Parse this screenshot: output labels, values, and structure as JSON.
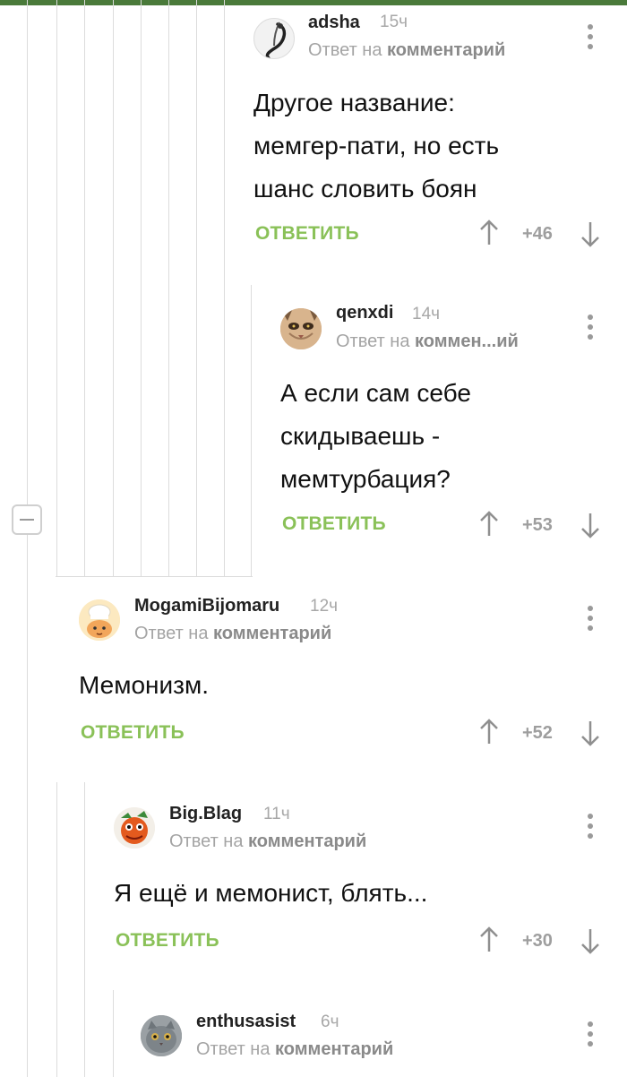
{
  "comments": [
    {
      "author": "adsha",
      "time": "15ч",
      "reply_prefix": "Ответ на",
      "reply_target": "комментарий",
      "text_lines": [
        "Другое название:",
        "мемгер-пати, но есть",
        "шанс словить боян"
      ],
      "reply_label": "ОТВЕТИТЬ",
      "score": "+46",
      "avatar_icon": "cord-loop-icon"
    },
    {
      "author": "qenxdi",
      "time": "14ч",
      "reply_prefix": "Ответ на",
      "reply_target": "коммен...ий",
      "text_lines": [
        "А если сам себе",
        "скидываешь -",
        "мемтурбация?"
      ],
      "reply_label": "ОТВЕТИТЬ",
      "score": "+53",
      "avatar_icon": "cat-face-icon"
    },
    {
      "author": "MogamiBijomaru",
      "time": "12ч",
      "reply_prefix": "Ответ на",
      "reply_target": "комментарий",
      "text_lines": [
        "Мемонизм."
      ],
      "reply_label": "ОТВЕТИТЬ",
      "score": "+52",
      "avatar_icon": "anime-chef-icon"
    },
    {
      "author": "Big.Blag",
      "time": "11ч",
      "reply_prefix": "Ответ на",
      "reply_target": "комментарий",
      "text_lines": [
        "Я ещё и мемонист, блять..."
      ],
      "reply_label": "ОТВЕТИТЬ",
      "score": "+30",
      "avatar_icon": "cartoon-character-icon"
    },
    {
      "author": "enthusasist",
      "time": "6ч",
      "reply_prefix": "Ответ на",
      "reply_target": "комментарий",
      "avatar_icon": "gray-cat-icon"
    }
  ],
  "colors": {
    "accent_green": "#8ac158",
    "top_bar": "#4a7a3a",
    "thread_line": "#dcdcdc",
    "muted_text": "#a4a4a4"
  }
}
